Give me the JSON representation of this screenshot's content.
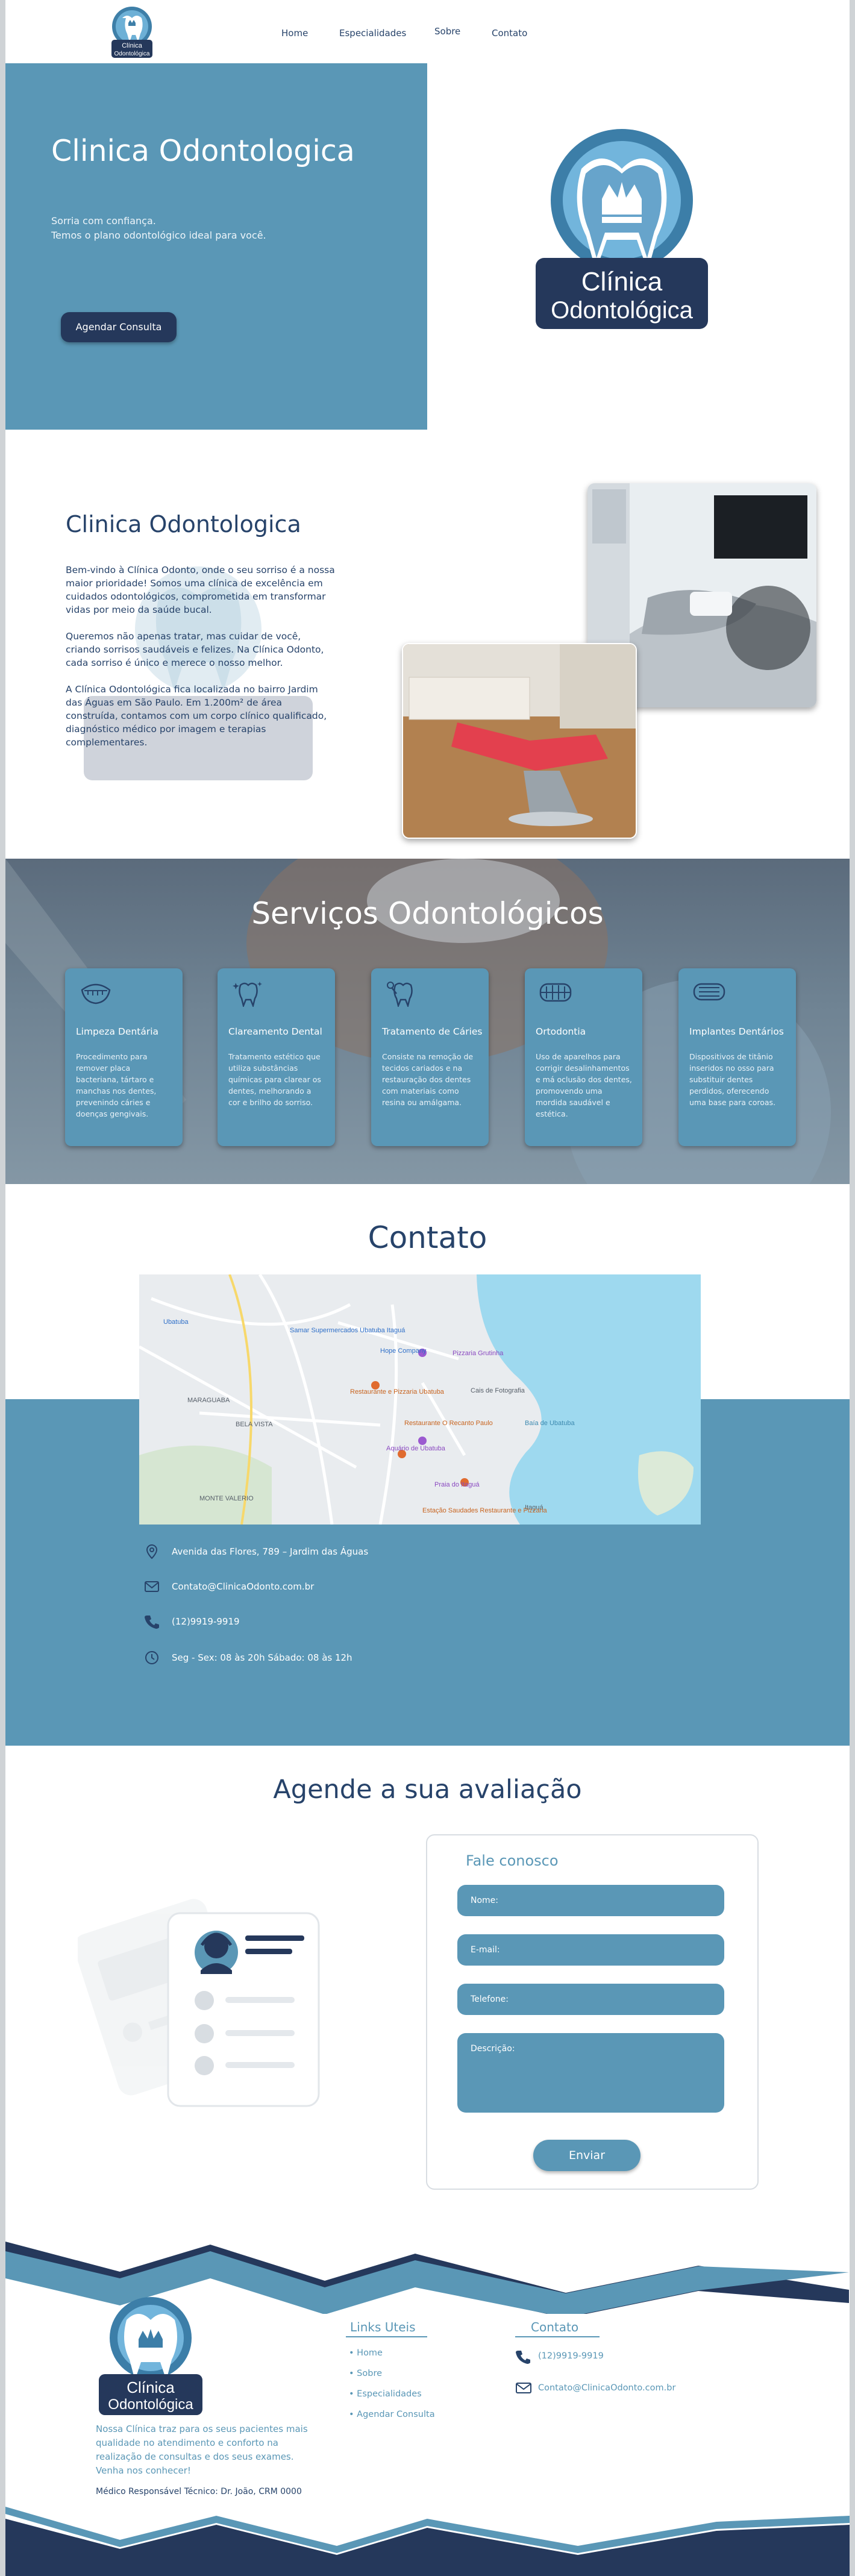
{
  "header": {
    "logo_line1": "Clínica",
    "logo_line2": "Odontológica",
    "nav": [
      {
        "label": "Home"
      },
      {
        "label": "Especialidades"
      },
      {
        "label": "Sobre"
      },
      {
        "label": "Contato"
      }
    ]
  },
  "hero": {
    "title": "Clinica Odontologica",
    "subtitle": "Sorria com confiança.\nTemos o plano odontológico ideal para você.",
    "cta_label": "Agendar Consulta",
    "logo_line1": "Clínica",
    "logo_line2": "Odontológica"
  },
  "about": {
    "title": "Clinica Odontologica",
    "paragraphs": [
      "Bem-vindo à Clínica Odonto, onde o seu sorriso é a nossa maior prioridade! Somos uma clínica de excelência em cuidados odontológicos, comprometida em transformar vidas por meio da saúde bucal.",
      "Queremos não apenas tratar, mas cuidar de você, criando sorrisos saudáveis e felizes. Na Clínica Odonto, cada sorriso é único e merece o nosso melhor.",
      "A Clínica Odontológica fica localizada no bairro Jardim das Águas em São Paulo. Em 1.200m² de área construída, contamos com um corpo clínico qualificado, diagnóstico médico por imagem e terapias complementares."
    ]
  },
  "services": {
    "title": "Serviços Odontológicos",
    "items": [
      {
        "icon": "mouth-icon",
        "title": "Limpeza Dentária",
        "text": "Procedimento para remover placa bacteriana, tártaro e manchas nos dentes, prevenindo cáries e doenças gengivais."
      },
      {
        "icon": "sparkling-tooth-icon",
        "title": "Clareamento Dental",
        "text": "Tratamento estético que utiliza substâncias químicas para clarear os dentes, melhorando a cor e brilho do sorriso."
      },
      {
        "icon": "tooth-repair-icon",
        "title": "Tratamento de Cáries",
        "text": "Consiste na remoção de tecidos cariados e na restauração dos dentes com materiais como resina ou amálgama."
      },
      {
        "icon": "braces-icon",
        "title": "Ortodontia",
        "text": "Uso de aparelhos para corrigir desalinhamentos e má oclusão dos dentes, promovendo uma mordida saudável e estética."
      },
      {
        "icon": "implant-icon",
        "title": "Implantes Dentários",
        "text": "Dispositivos de titânio inseridos no osso para substituir dentes perdidos, oferecendo uma base para coroas."
      }
    ]
  },
  "contact": {
    "title": "Contato",
    "map_labels": [
      "Ubatuba",
      "Samar Supermercados Ubatuba Itaguá",
      "Hope Company",
      "Restaurante e Pizzaria Ubatuba",
      "Restaurante O Recanto Paulo",
      "Aquário de Ubatuba",
      "Praia do Itaguá",
      "MONTE VALERIO",
      "BELA VISTA",
      "MARAGUABA",
      "Baía de Ubatuba",
      "Cais de Fotografia",
      "Pizzaria Grutinha",
      "Itaguá",
      "Estação Saudades Restaurante e Pizzaria"
    ],
    "address": "Avenida das Flores, 789 – Jardim das Águas",
    "email": "Contato@ClinicaOdonto.com.br",
    "phone": "(12)9919-9919",
    "hours": "Seg - Sex: 08 às 20h Sábado: 08 às 12h"
  },
  "agende": {
    "title": "Agende a sua avaliação",
    "form_title": "Fale conosco",
    "name_placeholder": "Nome:",
    "email_placeholder": "E-mail:",
    "phone_placeholder": "Telefone:",
    "desc_placeholder": "Descrição:",
    "send_label": "Enviar"
  },
  "footer": {
    "logo_line1": "Clínica",
    "logo_line2": "Odontológica",
    "description": "Nossa Clínica traz para os seus pacientes mais qualidade no atendimento e conforto na realização de consultas e dos seus exames. Venha nos conhecer!",
    "responsible": "Médico Responsável Técnico: Dr. João, CRM 0000",
    "links_title": "Links Uteis",
    "links": [
      "• Home",
      "• Sobre",
      "• Especialidades",
      "• Agendar Consulta"
    ],
    "contact_title": "Contato",
    "phone": "(12)9919-9919",
    "email": "Contato@ClinicaOdonto.com.br"
  },
  "colors": {
    "primary": "#5a97b6",
    "dark": "#25385b",
    "text": "#27436a"
  }
}
